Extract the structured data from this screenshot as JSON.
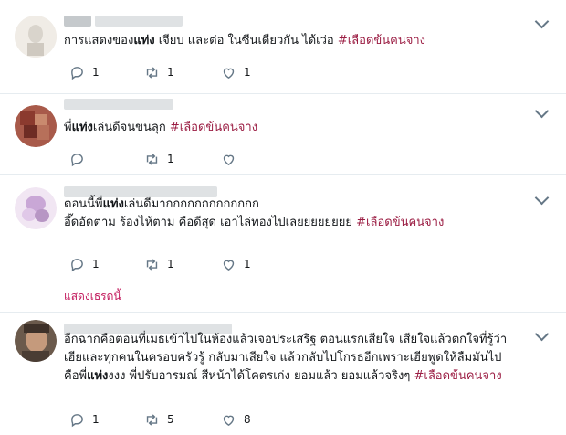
{
  "tweets": [
    {
      "text_parts": [
        "การแสดงของ",
        "แท่ง",
        " เจียบ และต่อ ในซีนเดียวกัน ได้เว่อ ",
        "#เลือดข้นคนจาง"
      ],
      "replies": "1",
      "retweets": "1",
      "likes": "1"
    },
    {
      "text_parts": [
        "พี่",
        "แท่ง",
        "เล่นดีจนขนลุก ",
        "#เลือดข้นคนจาง"
      ],
      "replies": "",
      "retweets": "1",
      "likes": ""
    },
    {
      "line1_parts": [
        "ตอนนี้พี่",
        "แท่ง",
        "เล่นดีมากกกกกกกกกกกกก"
      ],
      "line2_parts": [
        "อึ๊ดอัดตาม ร้องไห้ตาม คือดีสุด เอาไล่ทองไปเลยยยยยยยย ",
        "#เลือดข้นคนจาง"
      ],
      "replies": "1",
      "retweets": "1",
      "likes": "1"
    },
    {
      "line1": "อีกฉากคือตอนที่เมธเข้าไปในห้องแล้วเจอประเสริฐ ตอนแรกเสียใจ เสียใจแล้วตกใจที่รู้ว่า",
      "line2": "เฮียและทุกคนในครอบครัวรู้ กลับมาเสียใจ แล้วกลับไปโกรธอีกเพราะเฮียพูดให้ลืมมันไป",
      "line3_parts": [
        "คือพี่",
        "แท่ง",
        "งงง พี่ปรับอารมณ์ สีหน้าได้โคตรเก่ง ยอมแล้ว ยอมแล้วจริงๆ ",
        "#เลือดข้นคนจาง"
      ],
      "replies": "1",
      "retweets": "5",
      "likes": "8"
    }
  ],
  "show_thread_label": "แสดงเธรดนี้",
  "icons": {
    "reply": "reply-icon",
    "retweet": "retweet-icon",
    "like": "heart-icon",
    "more": "chevron-down-icon"
  },
  "colors": {
    "hashtag": "#9b1d43",
    "icon": "#657786",
    "divider": "#e6ecf0"
  }
}
